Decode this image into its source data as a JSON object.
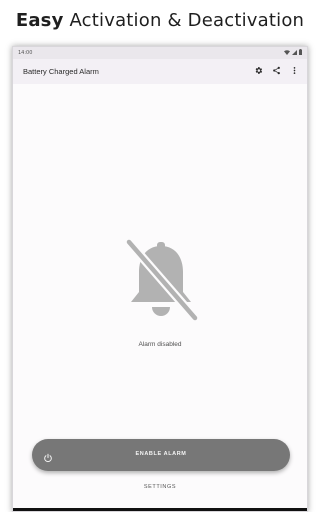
{
  "promo": {
    "headline_bold": "Easy",
    "headline_rest": "Activation & Deactivation"
  },
  "status_bar": {
    "time": "14:00"
  },
  "app_bar": {
    "title": "Battery Charged Alarm",
    "actions": [
      "gear-icon",
      "share-icon",
      "more-vert-icon"
    ]
  },
  "main": {
    "status_icon": "bell-off-icon",
    "status_text": "Alarm disabled",
    "enable_button": {
      "icon": "power-icon",
      "label": "ENABLE ALARM"
    },
    "settings_label": "SETTINGS"
  },
  "colors": {
    "button_bg": "#777777",
    "icon_gray": "#b2b2b2",
    "app_bar_bg": "#f3f0f5"
  }
}
